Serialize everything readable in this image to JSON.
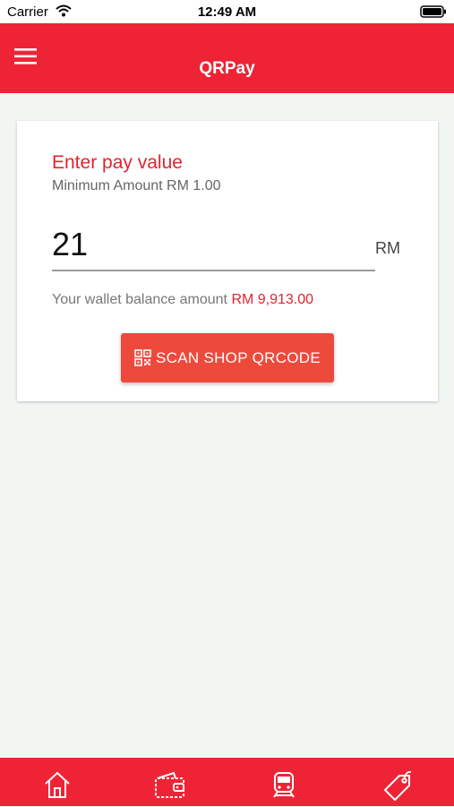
{
  "status_bar": {
    "carrier": "Carrier",
    "time": "12:49 AM"
  },
  "app_bar": {
    "title": "QRPay",
    "menu_icon": "hamburger-menu-icon"
  },
  "pay_card": {
    "heading": "Enter pay value",
    "minimum": "Minimum Amount RM 1.00",
    "amount_value": "21",
    "currency": "RM",
    "balance_label": "Your wallet balance amount",
    "balance_value": "RM 9,913.00",
    "scan_button_label": "SCAN SHOP QRCODE",
    "scan_button_icon": "qrcode-icon"
  },
  "bottom_nav": {
    "items": [
      {
        "icon": "home-icon"
      },
      {
        "icon": "wallet-icon"
      },
      {
        "icon": "train-icon"
      },
      {
        "icon": "tag-icon"
      }
    ]
  },
  "colors": {
    "brand_red": "#ee2436",
    "accent_red": "#e4232f",
    "button_red": "#ee4a3c",
    "background": "#f2f6f3"
  }
}
